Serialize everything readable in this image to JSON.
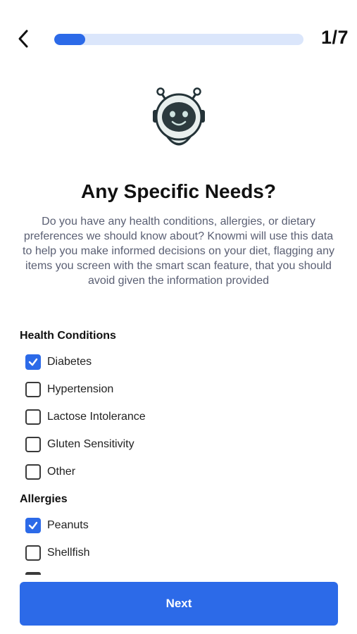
{
  "header": {
    "back_icon": "chevron-left-icon",
    "progress_fraction": 0.125,
    "step_counter": "1/7"
  },
  "mascot": {
    "icon": "robot-icon"
  },
  "title": "Any Specific Needs?",
  "description": "Do you have any health conditions, allergies, or dietary preferences we should know about? Knowmi will use this data to help you make informed decisions on your diet, flagging any items you screen with the smart scan feature, that you should avoid given the information provided",
  "sections": [
    {
      "label": "Health Conditions",
      "options": [
        {
          "label": "Diabetes",
          "checked": true
        },
        {
          "label": "Hypertension",
          "checked": false
        },
        {
          "label": "Lactose Intolerance",
          "checked": false
        },
        {
          "label": "Gluten Sensitivity",
          "checked": false
        },
        {
          "label": "Other",
          "checked": false
        }
      ]
    },
    {
      "label": "Allergies",
      "options": [
        {
          "label": "Peanuts",
          "checked": true
        },
        {
          "label": "Shellfish",
          "checked": false
        }
      ]
    }
  ],
  "next_button_label": "Next",
  "colors": {
    "accent": "#2c6ae8",
    "progress_track": "#dbe6fb",
    "description_text": "#5a5f73"
  }
}
